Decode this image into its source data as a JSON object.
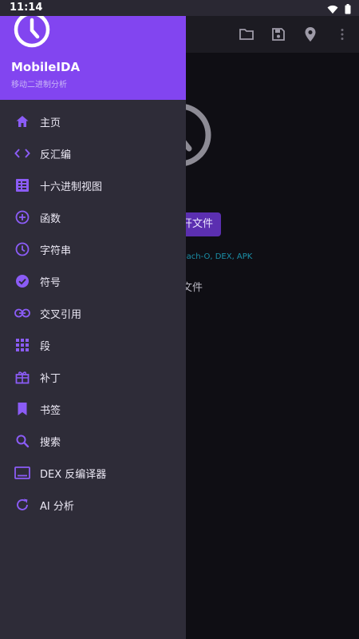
{
  "status_bar": {
    "time": "11:14"
  },
  "drawer": {
    "app_name": "MobileIDA",
    "subtitle": "移动二进制分析",
    "items": [
      {
        "label": "主页",
        "icon": "home-icon"
      },
      {
        "label": "反汇编",
        "icon": "code-icon"
      },
      {
        "label": "十六进制视图",
        "icon": "grid-list-icon"
      },
      {
        "label": "函数",
        "icon": "add-circle-icon"
      },
      {
        "label": "字符串",
        "icon": "clock-icon"
      },
      {
        "label": "符号",
        "icon": "check-circle-icon"
      },
      {
        "label": "交叉引用",
        "icon": "link-icon"
      },
      {
        "label": "段",
        "icon": "apps-grid-icon"
      },
      {
        "label": "补丁",
        "icon": "gift-icon"
      },
      {
        "label": "书签",
        "icon": "bookmark-icon"
      },
      {
        "label": "搜索",
        "icon": "search-icon"
      },
      {
        "label": "DEX 反编译器",
        "icon": "laptop-icon"
      },
      {
        "label": "AI 分析",
        "icon": "refresh-icon"
      }
    ]
  },
  "background": {
    "open_file_label": "打开文件",
    "open_file_visible": "开文件",
    "formats_visible": "Mach-O, DEX, APK",
    "recent_visible": "文件"
  },
  "colors": {
    "accent": "#8245f0",
    "drawer_bg": "#2e2c38",
    "icon_tint": "#8b5cf6",
    "app_bg": "#0f0e14"
  }
}
